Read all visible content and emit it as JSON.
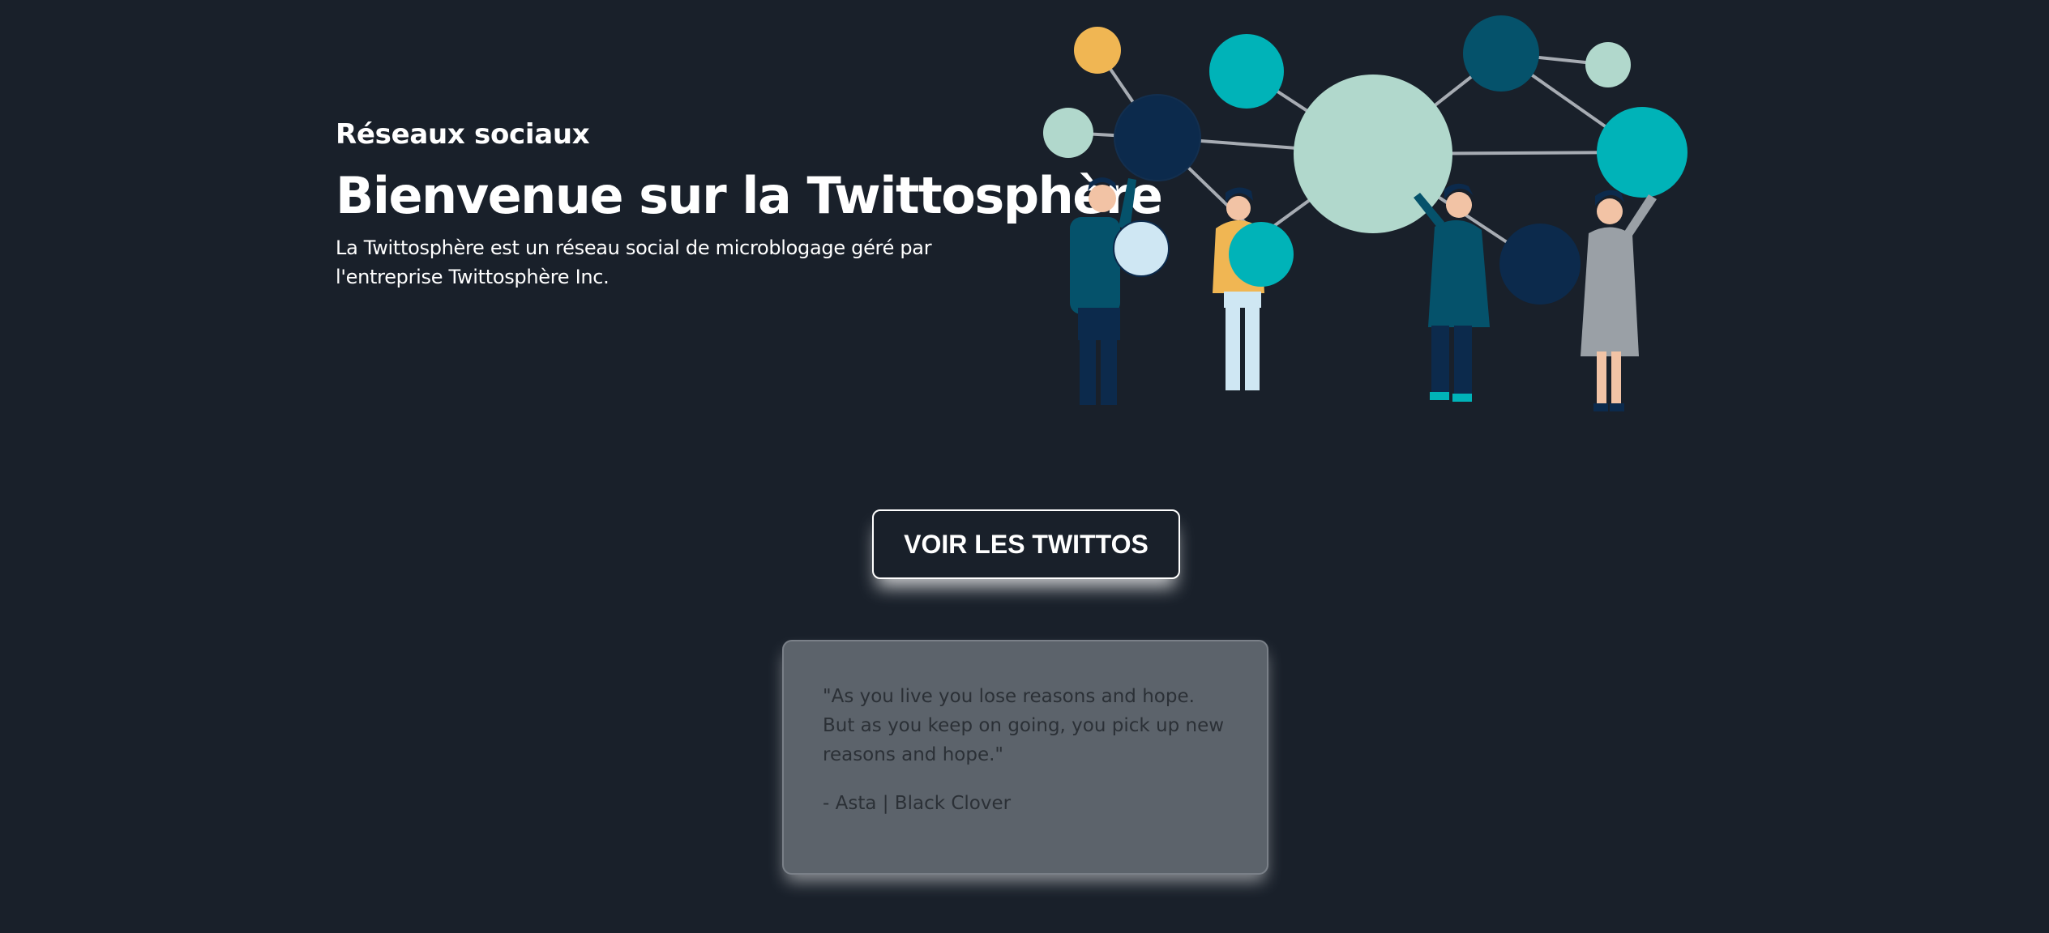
{
  "hero": {
    "eyebrow": "Réseaux sociaux",
    "title": "Bienvenue sur la Twittosphère",
    "description": "La Twittosphère est un réseau social de microblogage géré par l'entreprise Twittosphère Inc."
  },
  "cta": {
    "label": "VOIR LES TWITTOS"
  },
  "quote": {
    "text": "\"As you live you lose reasons and hope. But as you keep on going, you pick up new reasons and hope.\"",
    "author": "- Asta | Black Clover"
  },
  "illustration": {
    "icon": "people-network-illustration"
  },
  "colors": {
    "background": "#19202a",
    "teal": "#00b3b8",
    "mint": "#b1d8cc",
    "navy": "#0c2a4c",
    "yellow": "#f0b653",
    "card": "#5c636b"
  }
}
